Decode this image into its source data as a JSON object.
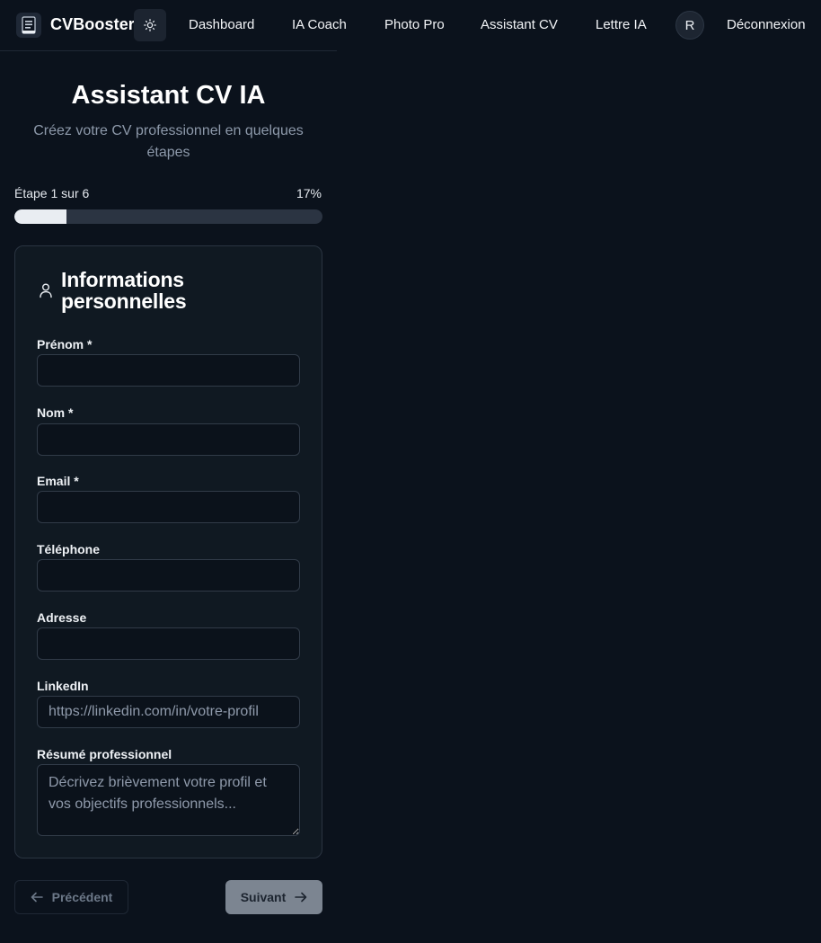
{
  "nav": {
    "brand": "CVBooster",
    "links": [
      "Dashboard",
      "IA Coach",
      "Photo Pro",
      "Assistant CV",
      "Lettre IA"
    ],
    "avatar_initial": "R",
    "logout": "Déconnexion"
  },
  "header": {
    "title": "Assistant CV IA",
    "subtitle": "Créez votre CV professionnel en quelques étapes"
  },
  "progress": {
    "step_label": "Étape 1 sur 6",
    "percent_label": "17%",
    "value": 0.17
  },
  "form": {
    "section_title": "Informations personnelles",
    "fields": {
      "first_name": {
        "label": "Prénom *",
        "value": "",
        "placeholder": ""
      },
      "last_name": {
        "label": "Nom *",
        "value": "",
        "placeholder": ""
      },
      "email": {
        "label": "Email *",
        "value": "",
        "placeholder": ""
      },
      "phone": {
        "label": "Téléphone",
        "value": "",
        "placeholder": ""
      },
      "address": {
        "label": "Adresse",
        "value": "",
        "placeholder": ""
      },
      "linkedin": {
        "label": "LinkedIn",
        "value": "",
        "placeholder": "https://linkedin.com/in/votre-profil"
      },
      "summary": {
        "label": "Résumé professionnel",
        "value": "",
        "placeholder": "Décrivez brièvement votre profil et vos objectifs professionnels..."
      }
    }
  },
  "buttons": {
    "previous": "Précédent",
    "next": "Suivant"
  },
  "colors": {
    "background": "#0b121c",
    "card": "#101922",
    "progress_fill": "#e9edf2",
    "progress_track": "#2b3442",
    "next_button": "#7c8591"
  },
  "icons": {
    "logo": "document-icon",
    "theme": "sun-icon",
    "section": "user-icon",
    "previous": "arrow-left-icon",
    "next": "arrow-right-icon"
  }
}
